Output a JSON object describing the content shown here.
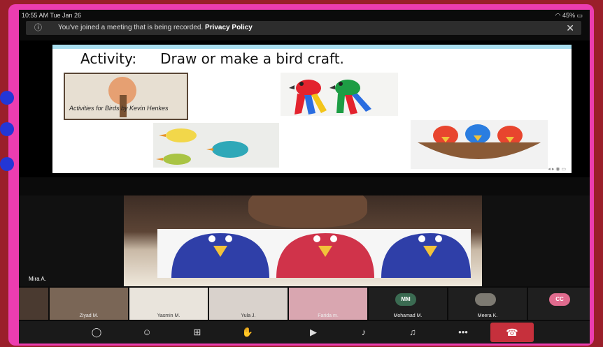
{
  "status_bar": {
    "time": "10:55 AM  Tue Jan 26",
    "battery": "45%"
  },
  "banner": {
    "message": "You've joined a meeting that is being recorded.",
    "link": "Privacy Policy",
    "info_icon": "info-icon",
    "close_icon": "close-icon"
  },
  "slide": {
    "title_label": "Activity:",
    "title_text": "Draw or make a bird craft.",
    "book_caption": "Activities for Birds by Kevin Henkes"
  },
  "speaker": {
    "name": "Mira A."
  },
  "participants": [
    {
      "name": "",
      "type": "video"
    },
    {
      "name": "Ziyad M.",
      "type": "video"
    },
    {
      "name": "Yasmin M.",
      "type": "video"
    },
    {
      "name": "Yula J.",
      "type": "video"
    },
    {
      "name": "Farida m.",
      "type": "video"
    },
    {
      "name": "Mohamad M.",
      "type": "avatar",
      "initials": "MM",
      "color": "#3b6b52"
    },
    {
      "name": "Meera K.",
      "type": "avatar",
      "initials": "",
      "color": "#7d7a72"
    },
    {
      "name": "",
      "type": "avatar",
      "initials": "CC",
      "color": "#e06b8e"
    }
  ],
  "toolbar": [
    "chat-icon",
    "participants-icon",
    "share-screen-icon",
    "raise-hand-icon",
    "video-off-icon",
    "mute-icon",
    "audio-icon",
    "more-icon",
    "end-call-icon"
  ],
  "colors": {
    "frame": "#ec3db0",
    "background": "#9a1f2a",
    "end_call": "#c6303c"
  }
}
